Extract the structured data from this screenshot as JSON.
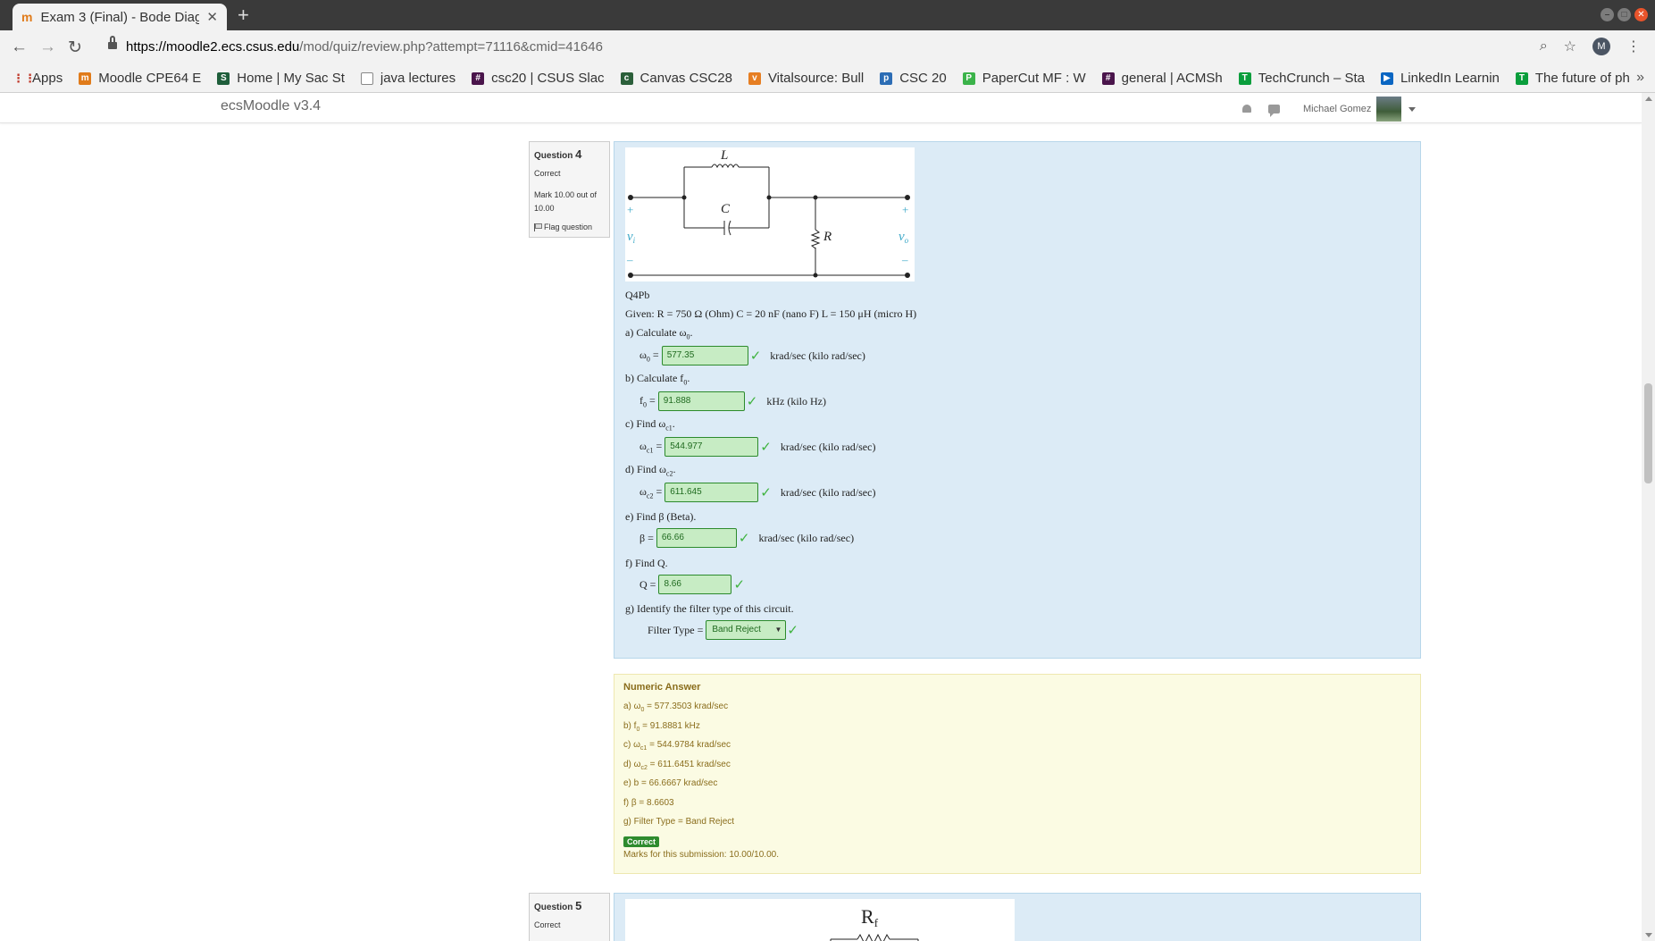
{
  "browser": {
    "tab_title": "Exam 3 (Final) - Bode Diag",
    "url_domain": "https://moodle2.ecs.csus.edu",
    "url_path": "/mod/quiz/review.php?attempt=71116&cmid=41646",
    "avatar_letter": "M",
    "bookmarks": [
      {
        "label": "Apps",
        "color": "#c0392b"
      },
      {
        "label": "Moodle CPE64 E",
        "color": "#e07b1a"
      },
      {
        "label": "Home | My Sac St",
        "color": "#1f5e3b"
      },
      {
        "label": "java lectures",
        "color": "#888888"
      },
      {
        "label": "csc20 | CSUS Slac",
        "color": "#4a154b"
      },
      {
        "label": "Canvas CSC28",
        "color": "#2b5f3a"
      },
      {
        "label": "Vitalsource: Bull",
        "color": "#e67e22"
      },
      {
        "label": "CSC 20",
        "color": "#2c6db5"
      },
      {
        "label": "PaperCut MF : W",
        "color": "#3bb34a"
      },
      {
        "label": "general | ACMSh",
        "color": "#4a154b"
      },
      {
        "label": "TechCrunch – Sta",
        "color": "#0a9e3c"
      },
      {
        "label": "LinkedIn Learnin",
        "color": "#0a66c2"
      },
      {
        "label": "The future of ph",
        "color": "#0a9e3c"
      }
    ]
  },
  "moodle": {
    "brand": "ecsMoodle v3.4",
    "user_name": "Michael Gomez"
  },
  "question4": {
    "label": "Question",
    "number": "4",
    "status": "Correct",
    "mark": "Mark 10.00 out of 10.00",
    "flag": "Flag question",
    "circuit": {
      "L": "L",
      "C": "C",
      "R": "R",
      "vi": "v",
      "vi_sub": "i",
      "vo": "v",
      "vo_sub": "o",
      "plus": "+",
      "minus": "–"
    },
    "id": "Q4Pb",
    "given": "Given: R = 750 Ω  (Ohm)     C = 20 nF (nano F)     L = 150 μH  (micro H)",
    "parts": {
      "a_text": "a)  Calculate ω",
      "a_sub": "0",
      "a_end": ".",
      "a_lhs": "ω",
      "a_lhs_sub": "0",
      "a_value": "577.35",
      "a_unit": "krad/sec (kilo rad/sec)",
      "b_text": "b)  Calculate f",
      "b_sub": "0",
      "b_end": ".",
      "b_lhs": "f",
      "b_lhs_sub": "0",
      "b_value": "91.888",
      "b_unit": "kHz  (kilo Hz)",
      "c_text": "c)  Find ω",
      "c_sub": "c1",
      "c_end": ".",
      "c_lhs": "ω",
      "c_lhs_sub": "c1",
      "c_value": "544.977",
      "c_unit": "krad/sec (kilo rad/sec)",
      "d_text": "d)  Find ω",
      "d_sub": "c2",
      "d_end": ".",
      "d_lhs": "ω",
      "d_lhs_sub": "c2",
      "d_value": "611.645",
      "d_unit": "krad/sec (kilo rad/sec)",
      "e_text": "e)  Find β (Beta).",
      "e_lhs": "β  =",
      "e_value": "66.66",
      "e_unit": "krad/sec (kilo rad/sec)",
      "f_text": "f)  Find Q.",
      "f_lhs": "Q =",
      "f_value": "8.66",
      "g_text": "g)  Identify the filter type of this circuit.",
      "g_lhs": "Filter Type =",
      "g_value": "Band Reject"
    },
    "equals": "=",
    "check": "✓",
    "feedback": {
      "title": "Numeric Answer",
      "a_pre": "a)  ω",
      "a_sub": "0",
      "a_post": " = 577.3503 krad/sec",
      "b_pre": "b)  f",
      "b_sub": "0",
      "b_post": " = 91.8881 kHz",
      "c_pre": "c)  ω",
      "c_sub": "c1",
      "c_post": " = 544.9784 krad/sec",
      "d_pre": "d)  ω",
      "d_sub": "c2",
      "d_post": " = 611.6451 krad/sec",
      "e_line": "e)  b  = 66.6667 krad/sec",
      "f_line": "f)  β = 8.6603",
      "g_line": "g)   Filter Type = Band Reject",
      "badge": "Correct",
      "marks": "Marks for this submission: 10.00/10.00."
    }
  },
  "question5": {
    "label": "Question",
    "number": "5",
    "status": "Correct",
    "resistor": "R",
    "resistor_sub": "f"
  }
}
